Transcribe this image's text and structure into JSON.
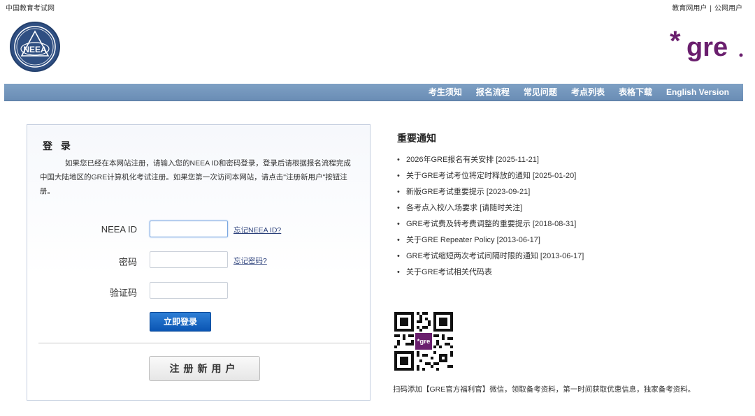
{
  "topbar": {
    "site_name": "中国教育考试网",
    "user_edu": "教育网用户",
    "separator": "|",
    "user_public": "公网用户"
  },
  "logos": {
    "neea": "NEEA",
    "gre": "gre"
  },
  "nav": {
    "items": [
      {
        "label": "考生须知"
      },
      {
        "label": "报名流程"
      },
      {
        "label": "常见问题"
      },
      {
        "label": "考点列表"
      },
      {
        "label": "表格下载"
      },
      {
        "label": "English Version"
      }
    ]
  },
  "login": {
    "title": "登 录",
    "description": "如果您已经在本网站注册，请输入您的NEEA ID和密码登录，登录后请根据报名流程完成中国大陆地区的GRE计算机化考试注册。如果您第一次访问本网站，请点击\"注册新用户\"按钮注册。",
    "neea_id_label": "NEEA ID",
    "neea_id_value": "",
    "forgot_id": "忘记NEEA ID?",
    "password_label": "密码",
    "password_value": "",
    "forgot_password": "忘记密码?",
    "captcha_label": "验证码",
    "captcha_value": "",
    "login_button": "立即登录",
    "register_button": "注册新用户"
  },
  "notice": {
    "title": "重要通知",
    "items": [
      "2026年GRE报名有关安排 [2025-11-21]",
      "关于GRE考试考位将定时释放的通知 [2025-01-20]",
      "新版GRE考试重要提示 [2023-09-21]",
      "各考点入校/入场要求 [请随时关注]",
      "GRE考试费及转考费调整的重要提示 [2018-08-31]",
      "关于GRE Repeater Policy [2013-06-17]",
      "GRE考试缩短两次考试间隔时限的通知 [2013-06-17]",
      "关于GRE考试相关代码表"
    ]
  },
  "qr": {
    "badge": "*gre",
    "caption": "扫码添加【GRE官方福利官】微信，领取备考资料，第一时间获取优惠信息，独家备考资料。"
  },
  "colors": {
    "nav_bar": "#7297bf",
    "gre_purple": "#6a1f6e",
    "login_button": "#0a55b3"
  }
}
